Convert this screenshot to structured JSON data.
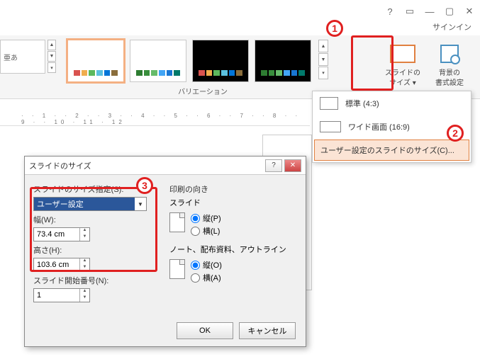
{
  "titlebar": {
    "signin": "サインイン"
  },
  "ribbon": {
    "theme_sample": "亜あ",
    "variation_label": "バリエーション",
    "slide_size": {
      "label_l1": "スライドの",
      "label_l2": "サイズ ▾"
    },
    "bg_format": {
      "label_l1": "背景の",
      "label_l2": "書式設定"
    }
  },
  "size_menu": {
    "standard": "標準 (4:3)",
    "wide": "ワイド画面 (16:9)",
    "custom": "ユーザー設定のスライドのサイズ(C)..."
  },
  "dialog": {
    "title": "スライドのサイズ",
    "size_spec_label": "スライドのサイズ指定(S):",
    "size_spec_value": "ユーザー設定",
    "width_label": "幅(W):",
    "width_value": "73.4 cm",
    "height_label": "高さ(H):",
    "height_value": "103.6 cm",
    "start_num_label": "スライド開始番号(N):",
    "start_num_value": "1",
    "print_orient_label": "印刷の向き",
    "slide_label": "スライド",
    "portrait_p": "縦(P)",
    "landscape_l": "横(L)",
    "notes_label": "ノート、配布資料、アウトライン",
    "portrait_o": "縦(O)",
    "landscape_a": "横(A)",
    "ok": "OK",
    "cancel": "キャンセル"
  },
  "callouts": {
    "c1": "1",
    "c2": "2",
    "c3": "3"
  },
  "ruler": "· · 1 · · 2 · · 3 · · 4 · · 5 · · 6 · · 7 · · 8 · · 9 · · 10 · 11 · 12"
}
